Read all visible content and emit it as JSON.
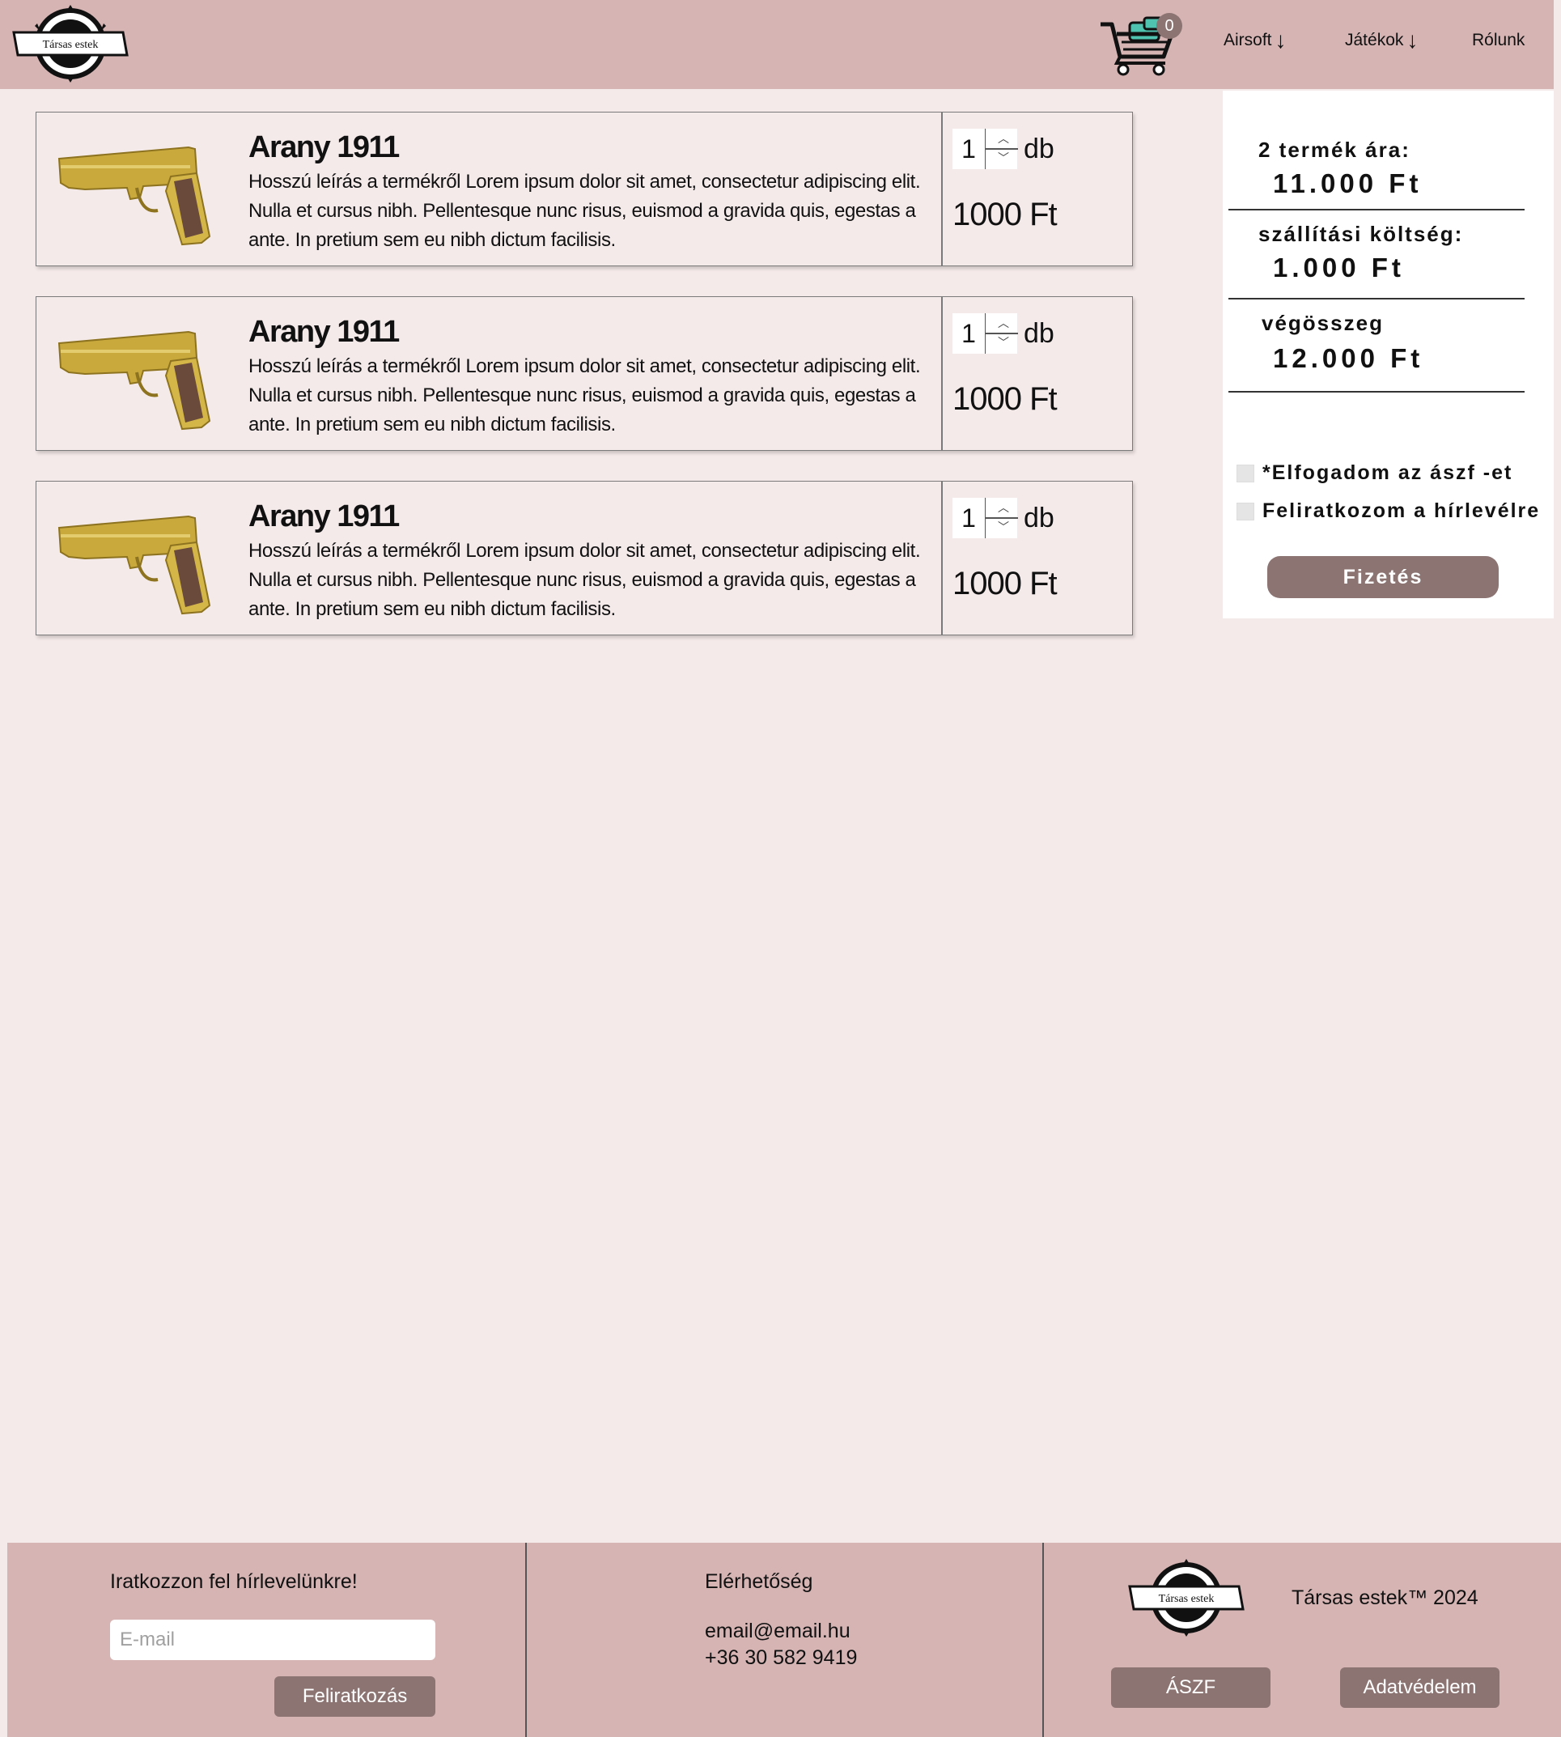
{
  "header": {
    "logo_text": "Társas estek",
    "cart_count": "0",
    "nav": [
      {
        "label": "Airsoft",
        "has_dropdown": true
      },
      {
        "label": "Játékok",
        "has_dropdown": true
      },
      {
        "label": "Rólunk",
        "has_dropdown": false
      }
    ]
  },
  "cart_items": [
    {
      "title": "Arany 1911",
      "description": "Hosszú leírás a termékről Lorem ipsum dolor sit amet, consectetur adipiscing elit. Nulla et cursus nibh. Pellentesque nunc risus, euismod a gravida quis, egestas a ante.  In pretium sem eu nibh dictum facilisis.",
      "quantity": "1",
      "unit": "db",
      "price": "1000 Ft"
    },
    {
      "title": "Arany 1911",
      "description": "Hosszú leírás a termékről Lorem ipsum dolor sit amet, consectetur adipiscing elit. Nulla et cursus nibh. Pellentesque nunc risus, euismod a gravida quis, egestas a ante.  In pretium sem eu nibh dictum facilisis.",
      "quantity": "1",
      "unit": "db",
      "price": "1000 Ft"
    },
    {
      "title": "Arany 1911",
      "description": "Hosszú leírás a termékről Lorem ipsum dolor sit amet, consectetur adipiscing elit. Nulla et cursus nibh. Pellentesque nunc risus, euismod a gravida quis, egestas a ante.  In pretium sem eu nibh dictum facilisis.",
      "quantity": "1",
      "unit": "db",
      "price": "1000 Ft"
    }
  ],
  "summary": {
    "products_label": "2 termék ára:",
    "products_value": "11.000 Ft",
    "shipping_label": "szállítási költség:",
    "shipping_value": "1.000 Ft",
    "total_label": "végösszeg",
    "total_value": "12.000 Ft",
    "terms_checkbox": "*Elfogadom az ászf -et",
    "newsletter_checkbox": "Feliratkozom a hírlevélre",
    "pay_button": "Fizetés"
  },
  "footer": {
    "newsletter_title": "Iratkozzon fel hírlevelünkre!",
    "email_placeholder": "E-mail",
    "subscribe_button": "Feliratkozás",
    "contact_title": "Elérhetőség",
    "contact_email": "email@email.hu",
    "contact_phone": "+36 30 582 9419",
    "logo_text": "Társas estek",
    "copyright": "Társas estek™ 2024",
    "terms_button": "ÁSZF",
    "privacy_button": "Adatvédelem"
  },
  "colors": {
    "header_bg": "#d5b4b3",
    "page_bg": "#f5eaea",
    "button_bg": "#8c7473",
    "gold": "#c9a93b"
  }
}
